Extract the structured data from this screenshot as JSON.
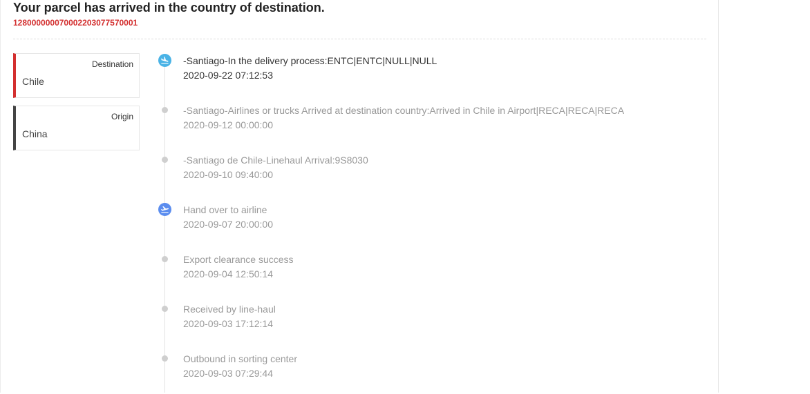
{
  "header": {
    "title": "Your parcel has arrived in the country of destination.",
    "tracking_number": "128000000070002203077570001"
  },
  "route": {
    "destination": {
      "label": "Destination",
      "value": "Chile",
      "accent_color": "#d32f2f"
    },
    "origin": {
      "label": "Origin",
      "value": "China",
      "accent_color": "#444444"
    }
  },
  "timeline": {
    "events": [
      {
        "text": "-Santiago-In the delivery process:ENTC|ENTC|NULL|NULL",
        "time": "2020-09-22 07:12:53",
        "icon": "plane-landing-icon",
        "active": true
      },
      {
        "text": "-Santiago-Airlines or trucks Arrived at destination country:Arrived in Chile in Airport|RECA|RECA|RECA",
        "time": "2020-09-12 00:00:00",
        "icon": "dot-icon",
        "active": false
      },
      {
        "text": "-Santiago de Chile-Linehaul Arrival:9S8030",
        "time": "2020-09-10 09:40:00",
        "icon": "dot-icon",
        "active": false
      },
      {
        "text": "Hand over to airline",
        "time": "2020-09-07 20:00:00",
        "icon": "plane-takeoff-icon",
        "active": false
      },
      {
        "text": "Export clearance success",
        "time": "2020-09-04 12:50:14",
        "icon": "dot-icon",
        "active": false
      },
      {
        "text": "Received by line-haul",
        "time": "2020-09-03 17:12:14",
        "icon": "dot-icon",
        "active": false
      },
      {
        "text": "Outbound in sorting center",
        "time": "2020-09-03 07:29:44",
        "icon": "dot-icon",
        "active": false
      }
    ]
  }
}
